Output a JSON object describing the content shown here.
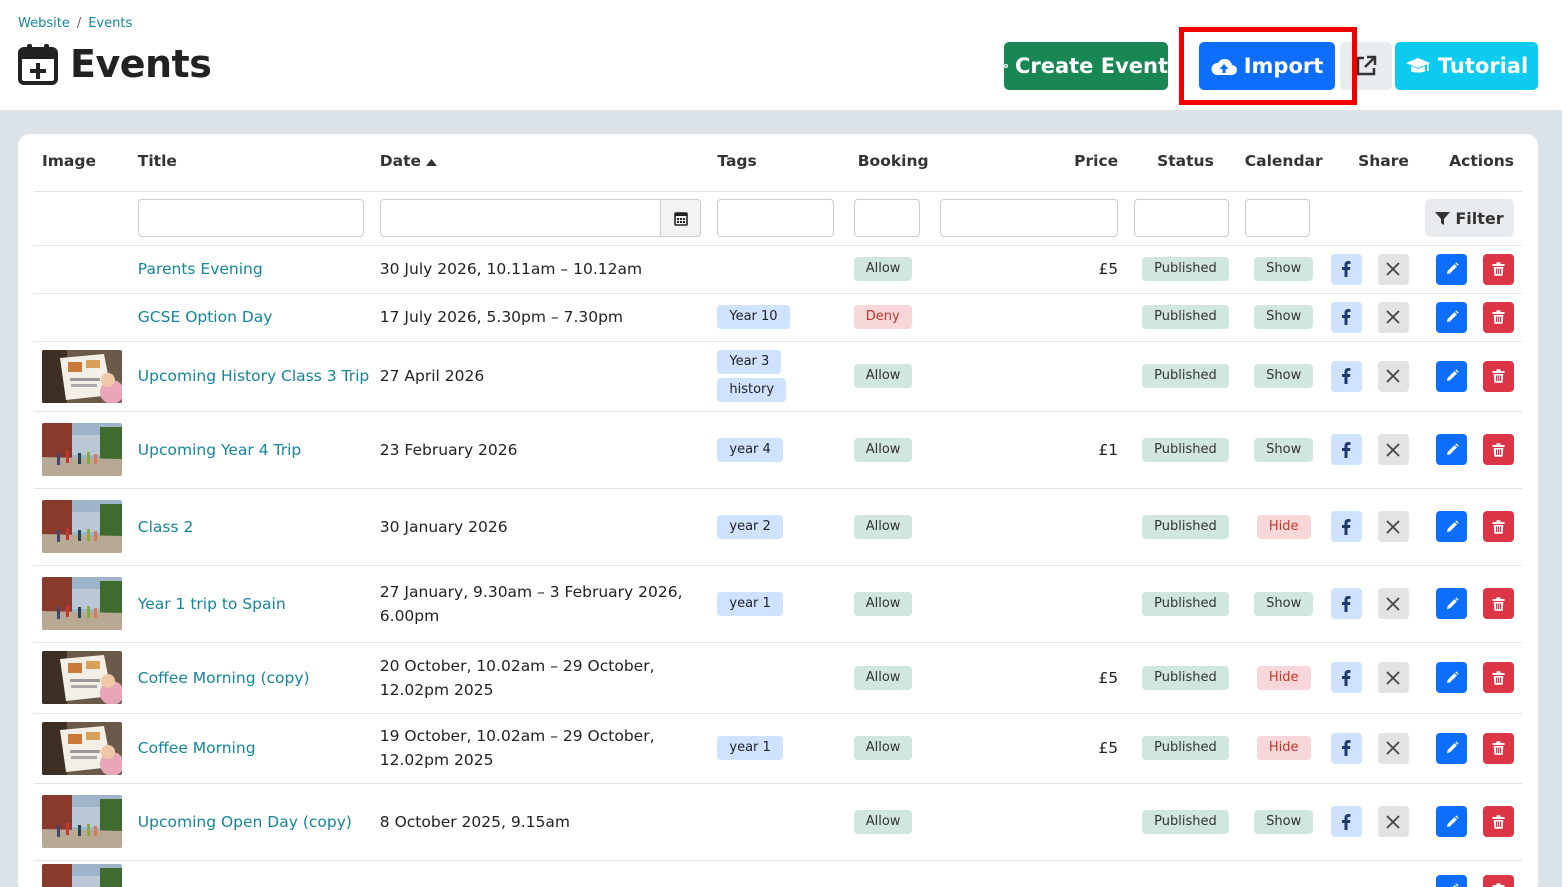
{
  "breadcrumb": {
    "items": [
      "Website",
      "Events"
    ],
    "separator": "/"
  },
  "page": {
    "title": "Events"
  },
  "toolbar": {
    "create_label": "Create Event",
    "import_label": "Import",
    "tutorial_label": "Tutorial"
  },
  "colors": {
    "create": "#198754",
    "import": "#0d6efd",
    "tutorial": "#0dcaf0",
    "highlight": "#f20000",
    "link": "#15859a"
  },
  "table": {
    "columns": {
      "image": "Image",
      "title": "Title",
      "date": "Date",
      "tags": "Tags",
      "booking": "Booking",
      "price": "Price",
      "status": "Status",
      "calendar": "Calendar",
      "share": "Share",
      "actions": "Actions"
    },
    "filter_label": "Filter",
    "rows": [
      {
        "title": "Parents Evening",
        "date": "30 July 2026, 10.11am – 10.12am",
        "tags": [],
        "booking": "Allow",
        "price": "£5",
        "status": "Published",
        "calendar": "Show",
        "image": ""
      },
      {
        "title": "GCSE Option Day",
        "date": "17 July 2026, 5.30pm – 7.30pm",
        "tags": [
          "Year 10"
        ],
        "booking": "Deny",
        "price": "",
        "status": "Published",
        "calendar": "Show",
        "image": ""
      },
      {
        "title": "Upcoming History Class 3 Trip",
        "date": "27 April 2026",
        "tags": [
          "Year 3",
          "history"
        ],
        "booking": "Allow",
        "price": "",
        "status": "Published",
        "calendar": "Show",
        "image": "paper-thumbnail"
      },
      {
        "title": "Upcoming Year 4 Trip",
        "date": "23 February 2026",
        "tags": [
          "year 4"
        ],
        "booking": "Allow",
        "price": "£1",
        "status": "Published",
        "calendar": "Show",
        "image": "street-thumbnail"
      },
      {
        "title": "Class 2",
        "date": "30 January 2026",
        "tags": [
          "year 2"
        ],
        "booking": "Allow",
        "price": "",
        "status": "Published",
        "calendar": "Hide",
        "image": "street-thumbnail"
      },
      {
        "title": "Year 1 trip to Spain",
        "date": "27 January, 9.30am – 3 February 2026, 6.00pm",
        "tags": [
          "year 1"
        ],
        "booking": "Allow",
        "price": "",
        "status": "Published",
        "calendar": "Show",
        "image": "street-thumbnail"
      },
      {
        "title": "Coffee Morning (copy)",
        "date": "20 October, 10.02am – 29 October, 12.02pm 2025",
        "tags": [],
        "booking": "Allow",
        "price": "£5",
        "status": "Published",
        "calendar": "Hide",
        "image": "paper-thumbnail"
      },
      {
        "title": "Coffee Morning",
        "date": "19 October, 10.02am – 29 October, 12.02pm 2025",
        "tags": [
          "year 1"
        ],
        "booking": "Allow",
        "price": "£5",
        "status": "Published",
        "calendar": "Hide",
        "image": "paper-thumbnail"
      },
      {
        "title": "Upcoming Open Day (copy)",
        "date": "8 October 2025, 9.15am",
        "tags": [],
        "booking": "Allow",
        "price": "",
        "status": "Published",
        "calendar": "Show",
        "image": "street-thumbnail"
      },
      {
        "title": "",
        "date": "",
        "tags": [],
        "booking": "",
        "price": "",
        "status": "",
        "calendar": "",
        "image": "street-thumbnail"
      }
    ]
  }
}
